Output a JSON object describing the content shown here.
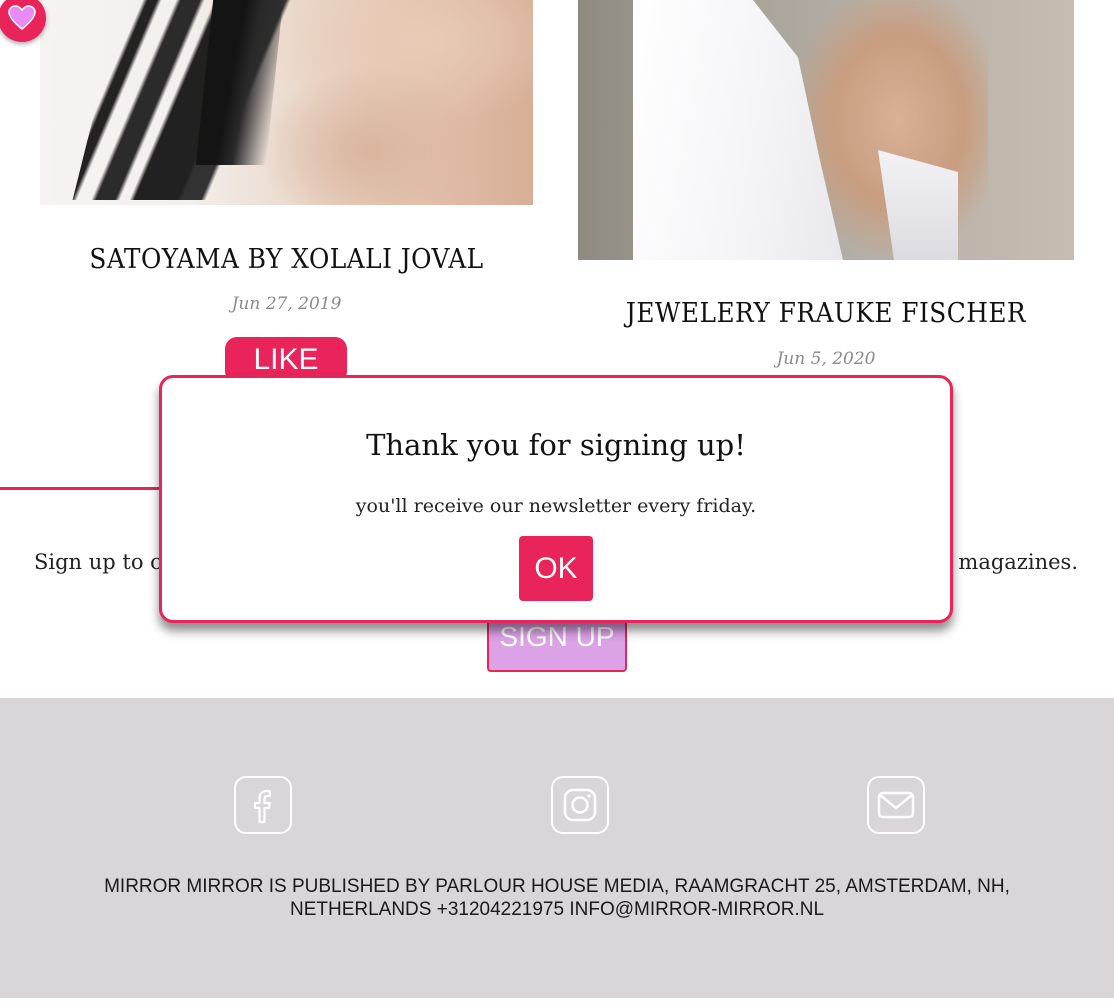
{
  "articles": [
    {
      "title": "SATOYAMA BY XOLALI JOVAL",
      "date": "Jun 27, 2019",
      "like_label": "LIKE"
    },
    {
      "title": "JEWELERY FRAUKE FISCHER",
      "date": "Jun 5, 2020"
    }
  ],
  "signup": {
    "text_left": "Sign up to c",
    "text_right": "l magazines.",
    "button_label": "SIGN UP"
  },
  "modal": {
    "title": "Thank you for signing up!",
    "message": "you'll receive our newsletter every friday.",
    "ok_label": "OK"
  },
  "footer": {
    "social_icons": [
      "facebook-icon",
      "instagram-icon",
      "mail-icon"
    ],
    "line1": "MIRROR MIRROR IS PUBLISHED BY PARLOUR HOUSE MEDIA, RAAMGRACHT 25, AMSTERDAM, NH,",
    "line2": "NETHERLANDS +31204221975 INFO@MIRROR-MIRROR.NL"
  },
  "colors": {
    "accent": "#e8245a",
    "signup_button": "#dba2e6",
    "footer_bg": "#d9d5d9"
  }
}
